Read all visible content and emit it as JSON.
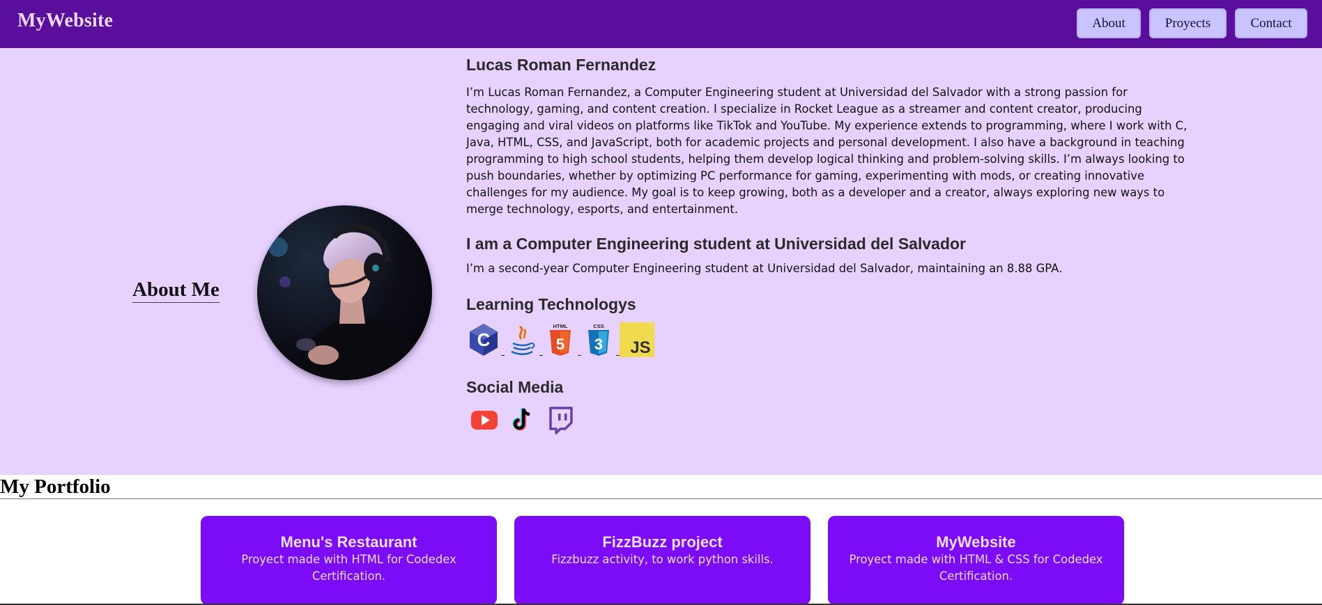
{
  "header": {
    "brand": "MyWebsite",
    "nav": [
      {
        "label": "About"
      },
      {
        "label": "Proyects"
      },
      {
        "label": "Contact"
      }
    ]
  },
  "about": {
    "section_title": "About Me",
    "name_heading": "Lucas Roman Fernandez",
    "bio": "I’m Lucas Roman Fernandez, a Computer Engineering student at Universidad del Salvador with a strong passion for technology, gaming, and content creation. I specialize in Rocket League as a streamer and content creator, producing engaging and viral videos on platforms like TikTok and YouTube. My experience extends to programming, where I work with C, Java, HTML, CSS, and JavaScript, both for academic projects and personal development. I also have a background in teaching programming to high school students, helping them develop logical thinking and problem-solving skills. I’m always looking to push boundaries, whether by optimizing PC performance for gaming, experimenting with mods, or creating innovative challenges for my audience. My goal is to keep growing, both as a developer and a creator, always exploring new ways to merge technology, esports, and entertainment.",
    "student_heading": "I am a Computer Engineering student at Universidad del Salvador",
    "student_text": "I’m a second-year Computer Engineering student at Universidad del Salvador, maintaining an 8.88 GPA.",
    "learning_heading": "Learning Technologys",
    "technologies": [
      {
        "icon": "c-icon",
        "label": "C"
      },
      {
        "icon": "java-icon",
        "label": "Java"
      },
      {
        "icon": "html5-icon",
        "label": "HTML",
        "caption": "HTML"
      },
      {
        "icon": "css3-icon",
        "label": "CSS",
        "caption": "CSS"
      },
      {
        "icon": "javascript-icon",
        "label": "JS"
      }
    ],
    "social_heading": "Social Media",
    "social": [
      {
        "icon": "youtube-icon"
      },
      {
        "icon": "tiktok-icon"
      },
      {
        "icon": "twitch-icon"
      }
    ]
  },
  "portfolio": {
    "title": "My Portfolio",
    "cards": [
      {
        "title": "Menu's Restaurant",
        "desc": "Proyect made with HTML for Codedex Certification."
      },
      {
        "title": "FizzBuzz project",
        "desc": "Fizzbuzz activity, to work python skills."
      },
      {
        "title": "MyWebsite",
        "desc": "Proyect made with HTML & CSS for Codedex Certification."
      }
    ]
  },
  "colors": {
    "header_bg": "#5a0f9c",
    "about_bg": "#e7d1ff",
    "nav_button": "#c9c4ff",
    "card_bg": "#7c0cf8"
  }
}
